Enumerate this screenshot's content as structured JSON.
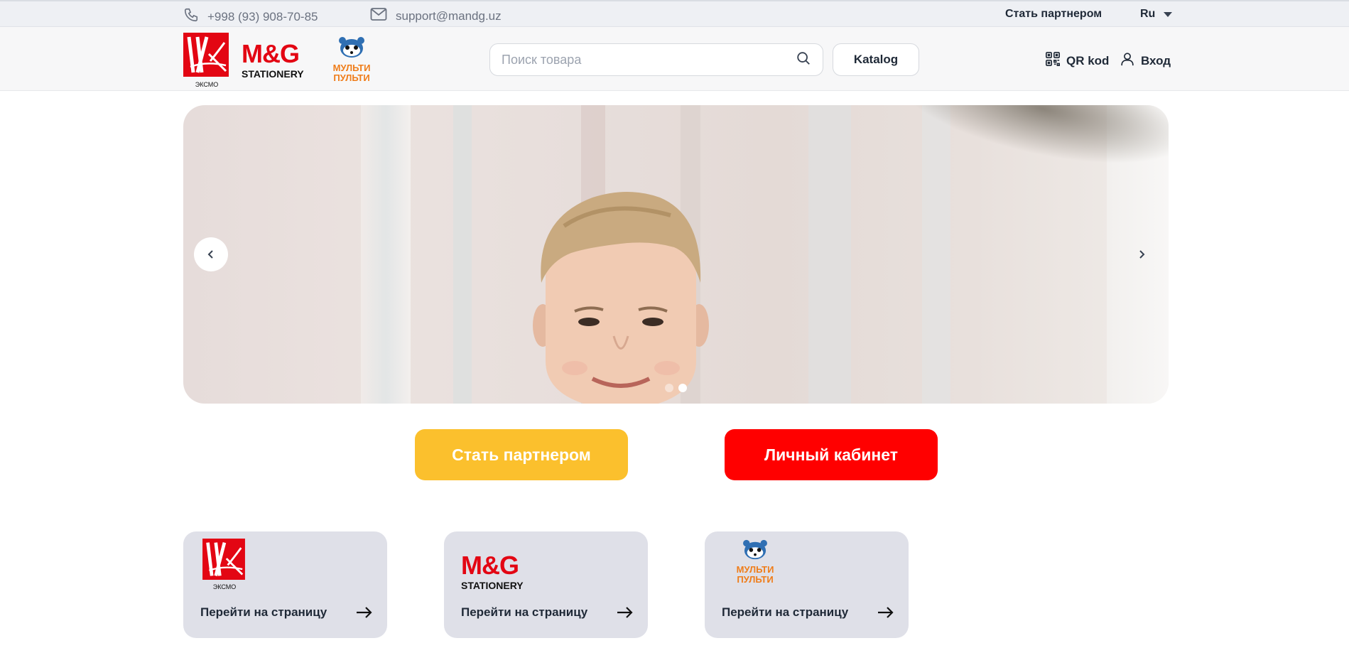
{
  "topbar": {
    "phone": "+998 (93) 908-70-85",
    "email": "support@mandg.uz",
    "partner_link": "Стать партнером",
    "language": "Ru"
  },
  "brands": {
    "eksmo_caption": "ЭКСМО",
    "mg_title": "M&G",
    "mg_subtitle": "STATIONERY",
    "multi_line1": "МУЛЬТИ",
    "multi_line2": "ПУЛЬТИ"
  },
  "header": {
    "search_placeholder": "Поиск товара",
    "catalog_label": "Katalog",
    "qr_label": "QR kod",
    "login_label": "Вход"
  },
  "hero": {
    "slide_count": 2,
    "active_slide": 2
  },
  "cta": {
    "partner_label": "Стать партнером",
    "cabinet_label": "Личный кабинет",
    "partner_color": "#fbc02d",
    "cabinet_color": "#ff0000"
  },
  "cards": [
    {
      "brand": "eksmo",
      "caption": "ЭКСМО",
      "link": "Перейти на страницу"
    },
    {
      "brand": "mg",
      "title": "M&G",
      "subtitle": "STATIONERY",
      "link": "Перейти на страницу"
    },
    {
      "brand": "multi",
      "line1": "МУЛЬТИ",
      "line2": "ПУЛЬТИ",
      "link": "Перейти на страницу"
    }
  ],
  "colors": {
    "eksmo_red": "#e30613",
    "multi_orange": "#ef7d1a",
    "multi_blue": "#2f6fb3"
  },
  "icons": {
    "phone": "phone-icon",
    "email": "mail-icon",
    "search": "search-icon",
    "qr": "qr-code-icon",
    "user": "user-icon",
    "prev": "chevron-left-icon",
    "next": "chevron-right-icon",
    "arrow": "arrow-right-icon"
  }
}
